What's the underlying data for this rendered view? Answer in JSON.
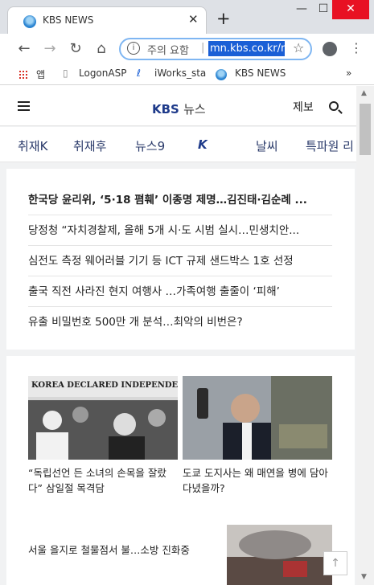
{
  "browser": {
    "tab_title": "KBS NEWS",
    "tab_close": "✕",
    "new_tab": "+",
    "window_min": "—",
    "window_max": "☐",
    "window_close": "✕",
    "omnibox_warning": "주의 요함",
    "omnibox_separator": "|",
    "omnibox_url": "mn.kbs.co.kr/n",
    "bookmarks": [
      "앱",
      "LogonASP",
      "iWorks_sta",
      "KBS NEWS"
    ],
    "bookmarks_more": "»"
  },
  "site": {
    "logo_main": "KBS",
    "logo_sub": "뉴스",
    "report_label": "제보",
    "nav": [
      "취재K",
      "취재후",
      "뉴스9",
      "K",
      "날씨",
      "특파원 리"
    ]
  },
  "headlines": [
    "한국당 윤리위, ‘5·18 폄훼’ 이종명 제명…김진태·김순례 ...",
    "당정청 “자치경찰제, 올해 5개 시·도 시범 실시…민생치안...",
    "심전도 측정 웨어러블 기기 등 ICT 규제 샌드박스 1호 선정",
    "출국 직전 사라진 현지 여행사 …가족여행 출줄이 ‘피해’",
    "유출 비밀번호 500만 개 분석…최악의 비번은?"
  ],
  "cards": [
    {
      "caption": "“독립선언 든 소녀의 손목을 잘랐다” 삼일절 목격담",
      "photo_text": "KOREA DECLARED INDEPENDE"
    },
    {
      "caption": "도쿄 도지사는 왜 매연을 병에 담아 다녔을까?"
    }
  ],
  "row_item": "서울 을지로 철물점서 불…소방 진화중",
  "to_top": "↑",
  "colors": {
    "accent": "#1e3a8a",
    "close_red": "#e81123",
    "url_highlight": "#1a5fd6"
  }
}
